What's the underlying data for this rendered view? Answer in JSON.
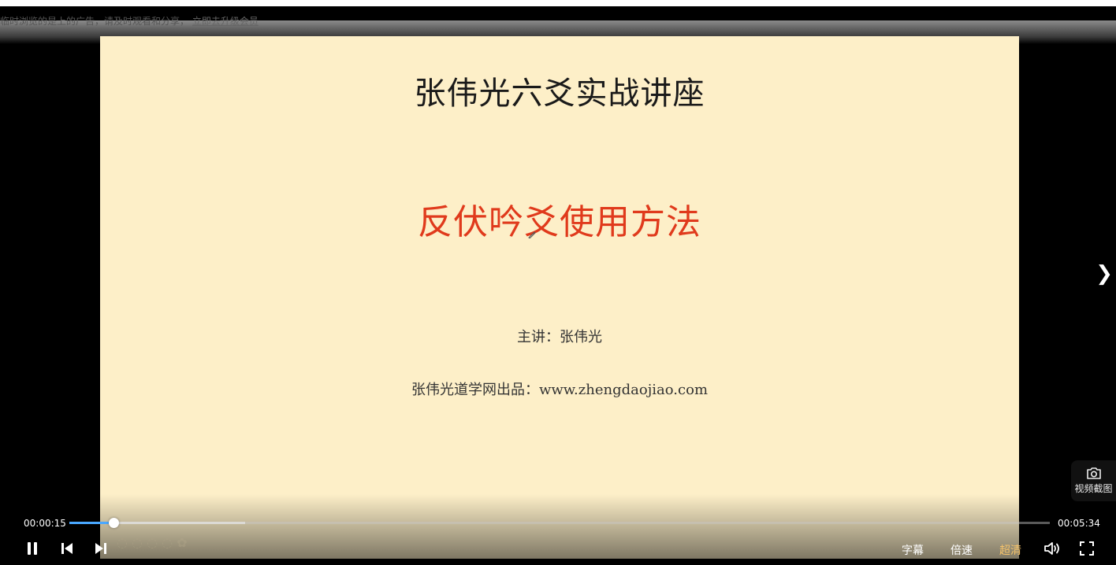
{
  "page": {
    "notice_text": "临时浏览的是上的广告，请及时观看和分享，",
    "notice_link": "立即去升级会员"
  },
  "slide": {
    "title": "张伟光六爻实战讲座",
    "subtitle": "反伏吟爻使用方法",
    "presenter": "主讲：张伟光",
    "source": "张伟光道学网出品：www.zhengdaojiao.com",
    "title_color": "#1a1a1a",
    "subtitle_color": "#e03a1c",
    "background": "#fdefc8"
  },
  "player": {
    "current_time": "00:00:15",
    "total_time": "00:05:34",
    "played_fraction": 0.045,
    "buffered_fraction": 0.179,
    "accent_color": "#4aa8ff",
    "screenshot_label": "视频截图",
    "subtitle_label": "字幕",
    "speed_label": "倍速",
    "quality_label": "超清",
    "quality_color": "#f5c36b",
    "icons": {
      "play_pause": "pause-icon",
      "prev": "previous-icon",
      "next": "next-icon",
      "volume": "volume-icon",
      "fullscreen": "fullscreen-icon",
      "screenshot": "camera-icon",
      "side_next": "chevron-right-icon"
    }
  }
}
